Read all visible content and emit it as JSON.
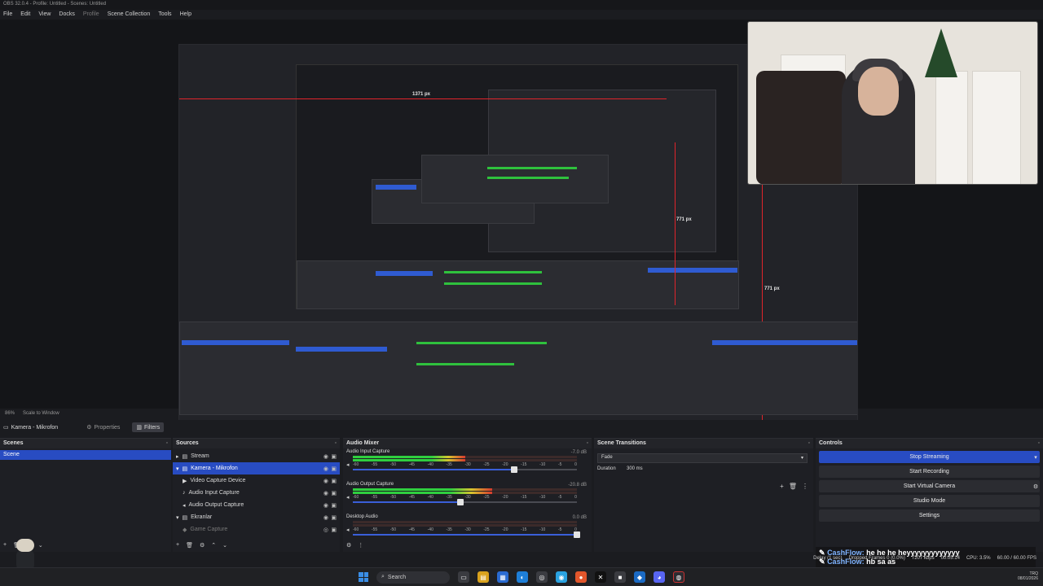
{
  "window": {
    "title": "OBS 32.0.4 - Profile: Untitled - Scenes: Untitled"
  },
  "menu": [
    "File",
    "Edit",
    "View",
    "Docks",
    "Profile",
    "Scene Collection",
    "Tools",
    "Help"
  ],
  "preview": {
    "label_width": "1371 px",
    "label_height_inner": "771 px",
    "label_height_outer": "771 px",
    "zoom": "86%",
    "scale_mode": "Scale to Window"
  },
  "source_toolbar": {
    "current_source": "Kamera - Mikrofon",
    "properties_label": "Properties",
    "filters_label": "Filters"
  },
  "scenes": {
    "title": "Scenes",
    "items": [
      "Scene"
    ]
  },
  "sources": {
    "title": "Sources",
    "items": [
      {
        "label": "Stream",
        "type": "group"
      },
      {
        "label": "Kamera - Mikrofon",
        "type": "group"
      },
      {
        "label": "Video Capture Device",
        "type": "camera"
      },
      {
        "label": "Audio Input Capture",
        "type": "mic"
      },
      {
        "label": "Audio Output Capture",
        "type": "speaker"
      },
      {
        "label": "Ekranlar",
        "type": "group"
      },
      {
        "label": "Game Capture",
        "type": "game"
      }
    ]
  },
  "audio_mixer": {
    "title": "Audio Mixer",
    "ticks": [
      "-60",
      "-55",
      "-50",
      "-45",
      "-40",
      "-35",
      "-30",
      "-25",
      "-20",
      "-15",
      "-10",
      "-5",
      "0"
    ],
    "tracks": [
      {
        "name": "Audio Input Capture",
        "db": "-7.0 dB",
        "level": 0.5,
        "volume": 0.72
      },
      {
        "name": "Audio Output Capture",
        "db": "-20.8 dB",
        "level": 0.62,
        "volume": 0.48
      },
      {
        "name": "Desktop Audio",
        "db": "0.0 dB",
        "level": 0.0,
        "volume": 1.0
      }
    ]
  },
  "scene_transitions": {
    "title": "Scene Transitions",
    "transition": "Fade",
    "duration_label": "Duration",
    "duration_value": "300 ms"
  },
  "controls": {
    "title": "Controls",
    "buttons": [
      "Stop Streaming",
      "Start Recording",
      "Start Virtual Camera",
      "Studio Mode",
      "Settings"
    ]
  },
  "chat": [
    {
      "user": "CashFlow:",
      "text": "he he he heyyyyyyyyyyyyy"
    },
    {
      "user": "CashFlow:",
      "text": "hb sa as"
    }
  ],
  "status": {
    "delay": "Delay (1 sec)",
    "dropped": "Dropped Frames 0 (0.0%)",
    "bitrate": "7207 kbps",
    "time": "00:05:14",
    "cpu": "CPU: 3.5%",
    "fps": "60.00 / 60.00 FPS"
  },
  "taskbar": {
    "search_placeholder": "Search",
    "lang": "TRQ",
    "date": "08/01/2026"
  },
  "colors": {
    "accent": "#284cc2",
    "meter_green": "#2fcf3f",
    "guide_red": "#e0242b"
  }
}
